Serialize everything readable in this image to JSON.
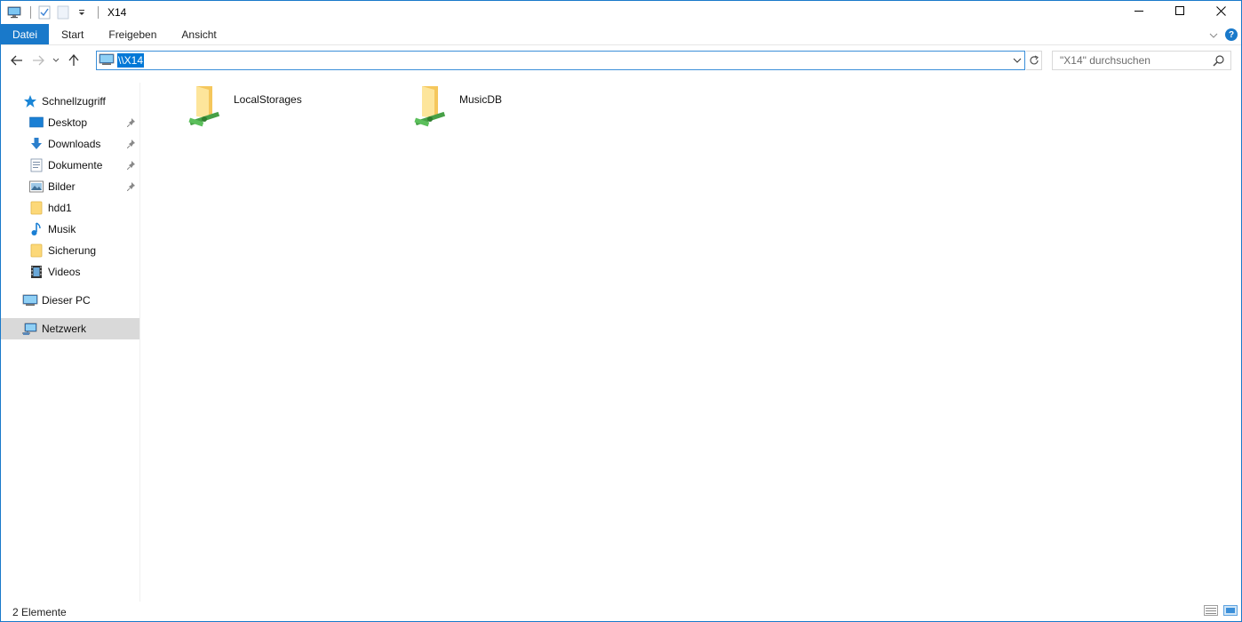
{
  "window": {
    "title": "X14"
  },
  "ribbon": {
    "tabs": [
      {
        "label": "Datei",
        "active": true
      },
      {
        "label": "Start"
      },
      {
        "label": "Freigeben"
      },
      {
        "label": "Ansicht"
      }
    ],
    "help_label": "?"
  },
  "address": {
    "path": "\\\\X14",
    "search_placeholder": "\"X14\" durchsuchen"
  },
  "nav": {
    "quick_access": "Schnellzugriff",
    "items": [
      {
        "label": "Desktop",
        "icon": "desktop-icon",
        "pinned": true
      },
      {
        "label": "Downloads",
        "icon": "download-icon",
        "pinned": true
      },
      {
        "label": "Dokumente",
        "icon": "document-icon",
        "pinned": true
      },
      {
        "label": "Bilder",
        "icon": "pictures-icon",
        "pinned": true
      },
      {
        "label": "hdd1",
        "icon": "folder-icon",
        "pinned": false
      },
      {
        "label": "Musik",
        "icon": "music-icon",
        "pinned": false
      },
      {
        "label": "Sicherung",
        "icon": "folder-icon",
        "pinned": false
      },
      {
        "label": "Videos",
        "icon": "video-icon",
        "pinned": false
      }
    ],
    "this_pc": "Dieser PC",
    "network": "Netzwerk"
  },
  "content": {
    "items": [
      {
        "label": "LocalStorages",
        "icon": "network-share-folder-icon"
      },
      {
        "label": "MusicDB",
        "icon": "network-share-folder-icon"
      }
    ]
  },
  "status": {
    "count": "2 Elemente"
  },
  "colors": {
    "accent": "#1979ca",
    "selection": "#0078d7",
    "nav_selected": "#d9d9d9"
  }
}
